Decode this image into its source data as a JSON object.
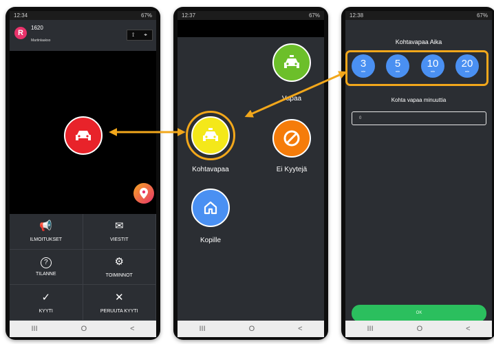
{
  "phone1": {
    "status": {
      "time": "12:34",
      "right": "67%"
    },
    "header": {
      "avatar": "R",
      "number": "1620",
      "name": "Martinlaakso"
    },
    "actions": [
      {
        "label": "ILMOITUKSET",
        "icon": "megaphone-icon",
        "glyph": "📢"
      },
      {
        "label": "VIESTIT",
        "icon": "mail-icon",
        "glyph": "✉"
      },
      {
        "label": "TILANNE",
        "icon": "help-icon",
        "glyph": "?"
      },
      {
        "label": "TOIMINNOT",
        "icon": "gears-icon",
        "glyph": "⚙"
      },
      {
        "label": "KYYTI",
        "icon": "check-icon",
        "glyph": "✓"
      },
      {
        "label": "PERUUTA KYYTI",
        "icon": "close-icon",
        "glyph": "✕"
      }
    ]
  },
  "phone2": {
    "status": {
      "time": "12:37",
      "right": "67%"
    },
    "options": [
      {
        "label": "Vapaa",
        "color": "#6cbf2a"
      },
      {
        "label": "Kohtavapaa",
        "color": "#f4e81a"
      },
      {
        "label": "Ei Kyytejä",
        "color": "#f57c0a"
      },
      {
        "label": "Kopille",
        "color": "#4a90f2"
      }
    ]
  },
  "phone3": {
    "status": {
      "time": "12:38",
      "right": "67%"
    },
    "title": "Kohtavapaa Aika",
    "minutes": [
      {
        "value": "3",
        "unit": "min"
      },
      {
        "value": "5",
        "unit": "min"
      },
      {
        "value": "10",
        "unit": "min"
      },
      {
        "value": "20",
        "unit": "min"
      }
    ],
    "input_label": "Kohta vapaa minuuttia",
    "input_value": "0",
    "ok": "OK"
  },
  "nav": {
    "recent": "III",
    "home": "O",
    "back": "<"
  },
  "colors": {
    "highlight": "#f2a71b",
    "red": "#e8232a",
    "accent_blue": "#4a90f2",
    "ok_green": "#2bbf5e"
  }
}
